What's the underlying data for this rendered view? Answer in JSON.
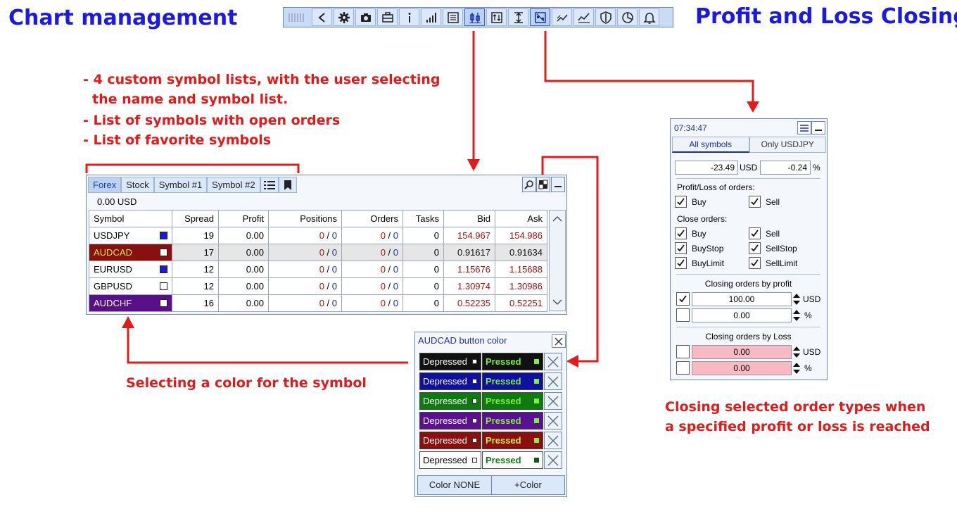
{
  "headings": {
    "left": "Chart management",
    "right": "Profit and Loss Closing"
  },
  "notes": {
    "line1": "- 4 custom symbol lists, with the user selecting",
    "line2": "the name and symbol list.",
    "line3": "- List of symbols with open orders",
    "line4": "- List of favorite symbols",
    "color_select": "Selecting a color for the symbol",
    "closing1": "Closing selected order types when",
    "closing2": "a specified profit or loss is reached"
  },
  "toolbar": {
    "icons": [
      "grip-icon",
      "back-icon",
      "gear-icon",
      "camera-icon",
      "briefcase-icon",
      "info-icon",
      "signal-bars-icon",
      "list-icon",
      "candles-icon",
      "sort-icon",
      "range-icon",
      "hedge-icon",
      "trend-icon",
      "chart-line-icon",
      "shield-icon",
      "pie-chart-icon",
      "bell-icon"
    ]
  },
  "panel": {
    "tabs": [
      "Forex",
      "Stock",
      "Symbol #1",
      "Symbol #2"
    ],
    "balance": "0.00 USD",
    "columns": [
      "Symbol",
      "Spread",
      "Profit",
      "Positions",
      "Orders",
      "Tasks",
      "Bid",
      "Ask"
    ],
    "rows": [
      {
        "symbol": "USDJPY",
        "spread": "19",
        "profit": "0.00",
        "pos_a": "0",
        "pos_b": "0",
        "ord_a": "0",
        "ord_b": "0",
        "tasks": "0",
        "bid": "154.967",
        "ask": "154.986",
        "bg": "#ffffff",
        "fg": "#000000",
        "sq": "#1a1ad8"
      },
      {
        "symbol": "AUDCAD",
        "spread": "17",
        "profit": "0.00",
        "pos_a": "0",
        "pos_b": "0",
        "ord_a": "0",
        "ord_b": "0",
        "tasks": "0",
        "bid": "0.91617",
        "ask": "0.91634",
        "bg": "#8a0f0f",
        "fg": "#d6e84a",
        "sq": "#ffffff"
      },
      {
        "symbol": "EURUSD",
        "spread": "12",
        "profit": "0.00",
        "pos_a": "0",
        "pos_b": "0",
        "ord_a": "0",
        "ord_b": "0",
        "tasks": "0",
        "bid": "1.15676",
        "ask": "1.15688",
        "bg": "#ffffff",
        "fg": "#000000",
        "sq": "#1a1ad8"
      },
      {
        "symbol": "GBPUSD",
        "spread": "12",
        "profit": "0.00",
        "pos_a": "0",
        "pos_b": "0",
        "ord_a": "0",
        "ord_b": "0",
        "tasks": "0",
        "bid": "1.30974",
        "ask": "1.30986",
        "bg": "#ffffff",
        "fg": "#000000",
        "sq": "#ffffff"
      },
      {
        "symbol": "AUDCHF",
        "spread": "16",
        "profit": "0.00",
        "pos_a": "0",
        "pos_b": "0",
        "ord_a": "0",
        "ord_b": "0",
        "tasks": "0",
        "bid": "0.52235",
        "ask": "0.52251",
        "bg": "#5a0f8a",
        "fg": "#ffffff",
        "sq": "#ffffff"
      }
    ]
  },
  "color_popup": {
    "title": "AUDCAD button color",
    "depressed_label": "Depressed",
    "pressed_label": "Pressed",
    "rows": [
      {
        "bg": "#111111",
        "pressed_bg": "#111111",
        "dep_fg": "#ffffff",
        "pr_fg": "#7cf03a",
        "dot": "#ffffff",
        "pdot": "#7cf03a"
      },
      {
        "bg": "#0f0fa0",
        "pressed_bg": "#0f0fa0",
        "dep_fg": "#ffffff",
        "pr_fg": "#7cf03a",
        "dot": "#ffffff",
        "pdot": "#7cf03a"
      },
      {
        "bg": "#0f7a0f",
        "pressed_bg": "#0f7a0f",
        "dep_fg": "#ffffff",
        "pr_fg": "#7cf03a",
        "dot": "#ffffff",
        "pdot": "#7cf03a"
      },
      {
        "bg": "#5a1090",
        "pressed_bg": "#5a1090",
        "dep_fg": "#ffffff",
        "pr_fg": "#7cf03a",
        "dot": "#ffffff",
        "pdot": "#7cf03a"
      },
      {
        "bg": "#8a0f0f",
        "pressed_bg": "#8a0f0f",
        "dep_fg": "#ffffff",
        "pr_fg": "#d6e84a",
        "dot": "#ffffff",
        "pdot": "#7cf03a"
      },
      {
        "bg": "#ffffff",
        "pressed_bg": "#ffffff",
        "dep_fg": "#000000",
        "pr_fg": "#0f7a0f",
        "dot": "#ffffff",
        "pdot": "#0f5a0f"
      }
    ],
    "color_none": "Color NONE",
    "add_color": "+Color"
  },
  "right_panel": {
    "time": "07:34:47",
    "tab_all": "All symbols",
    "tab_only": "Only USDJPY",
    "profit_value": "-23.49",
    "currency": "USD",
    "percent_value": "-0.24",
    "percent_sign": "%",
    "pl_orders_label": "Profit/Loss of orders:",
    "buy": "Buy",
    "sell": "Sell",
    "close_orders_label": "Close orders:",
    "buy_stop": "BuyStop",
    "sell_stop": "SellStop",
    "buy_limit": "BuyLimit",
    "sell_limit": "SellLimit",
    "closing_profit_label": "Closing orders by profit",
    "profit_usd_value": "100.00",
    "profit_pct_value": "0.00",
    "closing_loss_label": "Closing orders by Loss",
    "loss_usd_value": "0.00",
    "loss_pct_value": "0.00"
  },
  "colors": {
    "heading_blue": "#1a1ae0",
    "note_red": "#e01b1b",
    "panel_bg": "#f4f8fd",
    "loss_field_bg": "#f7b9c2"
  }
}
